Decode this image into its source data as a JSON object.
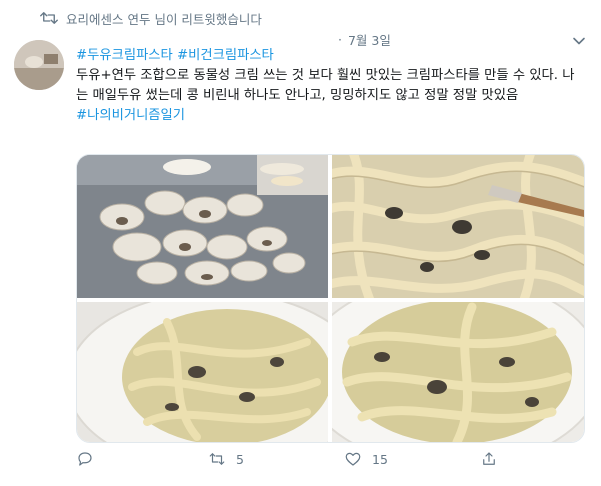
{
  "retweet_notice": "요리에센스 연두 님이 리트윗했습니다",
  "tweet": {
    "dot": "·",
    "date": "7월 3일",
    "hashtags_line1": [
      "#두유크림파스타",
      "#비건크림파스타"
    ],
    "body": "두유+연두 조합으로 동물성 크림 쓰는 것 보다 훨씬 맛있는 크림파스타를 만들 수 있다. 나는 매일두유 썼는데 콩 비린내 하나도 안나고, 밍밍하지도 않고 정말 정말 맛있음",
    "hashtag_line3": "#나의비거니즘일기"
  },
  "actions": {
    "retweet_count": "5",
    "like_count": "15"
  },
  "icons": {
    "retweet": "retweet-icon",
    "reply": "reply-icon",
    "like": "heart-icon",
    "share": "share-icon",
    "more": "chevron-down-icon"
  },
  "colors": {
    "link": "#1b95e0",
    "secondary": "#657786"
  }
}
